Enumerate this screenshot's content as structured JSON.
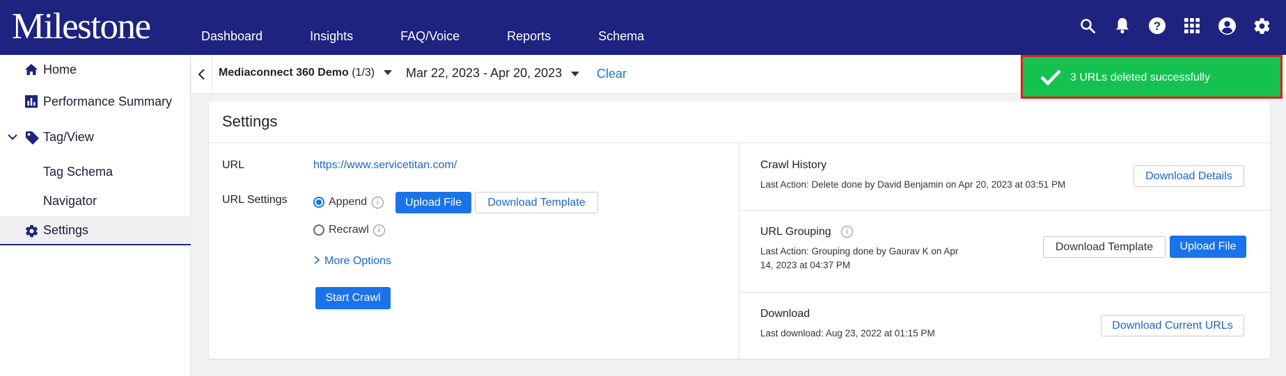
{
  "brand": {
    "logo_text": "Milestone"
  },
  "nav": {
    "items": [
      "Dashboard",
      "Insights",
      "FAQ/Voice",
      "Reports",
      "Schema"
    ]
  },
  "top_icons": [
    "search-icon",
    "bell-icon",
    "help-icon",
    "apps-grid-icon",
    "account-icon",
    "settings-gear-icon"
  ],
  "sidebar": {
    "items": [
      {
        "label": "Home",
        "icon": "home-icon"
      },
      {
        "label": "Performance Summary",
        "icon": "bar-chart-icon"
      },
      {
        "label": "Tag/View",
        "icon": "tag-icon"
      },
      {
        "label": "Tag Schema"
      },
      {
        "label": "Navigator"
      },
      {
        "label": "Settings",
        "icon": "gear-icon"
      }
    ]
  },
  "filters": {
    "account_name": "Mediaconnect 360 Demo",
    "account_count": "(1/3)",
    "date_range": "Mar 22, 2023 - Apr 20, 2023",
    "clear_label": "Clear"
  },
  "toast": {
    "message": "3 URLs deleted successfully",
    "color": "#15c250"
  },
  "settings": {
    "title": "Settings",
    "url_label": "URL",
    "url_value": "https://www.servicetitan.com/",
    "url_settings_label": "URL Settings",
    "append_label": "Append",
    "recrawl_label": "Recrawl",
    "selected_mode": "Append",
    "upload_file_label": "Upload File",
    "download_template_label": "Download Template",
    "more_options_label": "More Options",
    "start_crawl_label": "Start Crawl"
  },
  "crawl_history": {
    "title": "Crawl History",
    "desc": "Last Action: Delete done by David Benjamin on Apr 20, 2023 at 03:51 PM",
    "button": "Download Details"
  },
  "url_grouping": {
    "title": "URL Grouping",
    "desc_line1": "Last Action: Grouping done by Gaurav K on Apr",
    "desc_line2": "14, 2023 at 04:37 PM",
    "download_template_label": "Download Template",
    "upload_file_label": "Upload File"
  },
  "download": {
    "title": "Download",
    "desc": "Last download: Aug 23, 2022 at 01:15 PM",
    "button": "Download Current URLs"
  },
  "colors": {
    "header": "#1d237e",
    "primary": "#1a73e8",
    "link": "#1a66c9",
    "toast": "#15c250"
  }
}
